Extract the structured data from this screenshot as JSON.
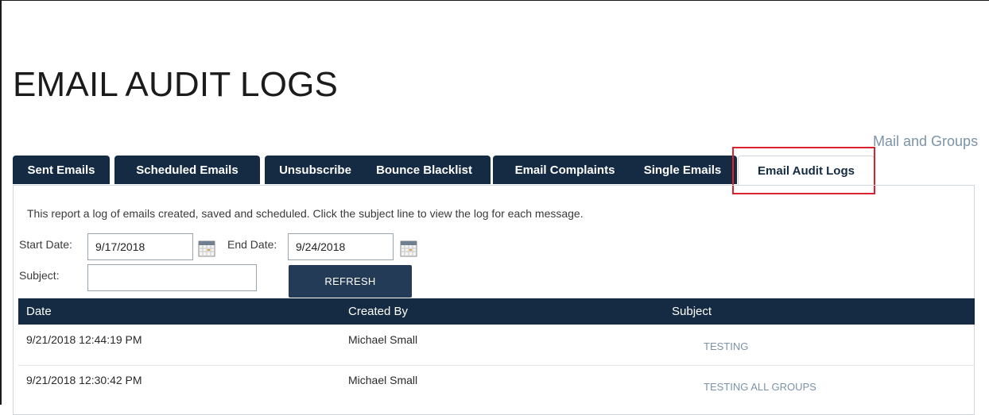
{
  "page": {
    "title": "EMAIL AUDIT LOGS",
    "top_link": "Mail and Groups"
  },
  "tabs": [
    {
      "label": "Sent Emails",
      "active": false
    },
    {
      "label": "Scheduled Emails",
      "active": false
    },
    {
      "label": "Unsubscribe",
      "active": false
    },
    {
      "label": "Bounce Blacklist",
      "active": false
    },
    {
      "label": "Email Complaints",
      "active": false
    },
    {
      "label": "Single Emails",
      "active": false
    },
    {
      "label": "Email Audit Logs",
      "active": true
    }
  ],
  "report": {
    "description": "This report a log of emails created, saved and scheduled. Click the subject line to view the log for each message."
  },
  "filters": {
    "start_date_label": "Start Date:",
    "start_date_value": "9/17/2018",
    "end_date_label": "End Date:",
    "end_date_value": "9/24/2018",
    "subject_label": "Subject:",
    "subject_value": "",
    "calendar_icon": "calendar-icon",
    "refresh_label": "REFRESH"
  },
  "table": {
    "columns": [
      "Date",
      "Created By",
      "Subject"
    ],
    "rows": [
      {
        "date": "9/21/2018 12:44:19 PM",
        "created_by": "Michael Small",
        "subject": "TESTING"
      },
      {
        "date": "9/21/2018 12:30:42 PM",
        "created_by": "Michael Small",
        "subject": "TESTING ALL GROUPS"
      }
    ]
  },
  "colors": {
    "tab_bg": "#152b43",
    "header_bg": "#152b43",
    "button_bg": "#233b56",
    "link": "#7d93a8",
    "highlight": "#d9232e"
  }
}
